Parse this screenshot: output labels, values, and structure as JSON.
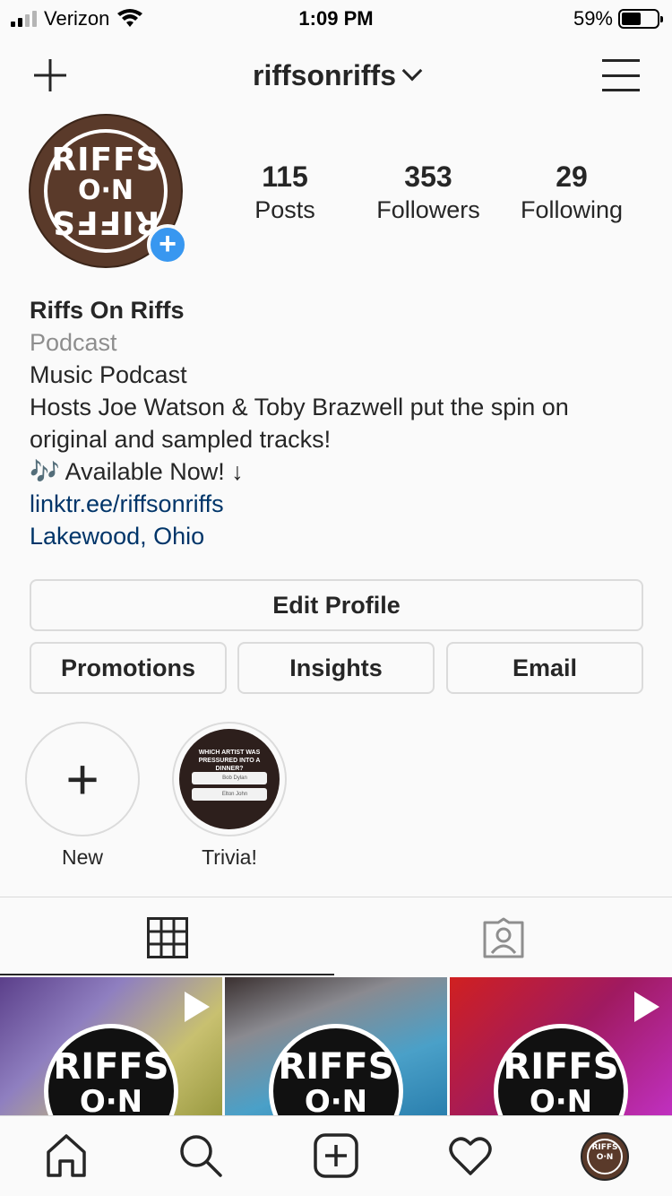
{
  "status_bar": {
    "carrier": "Verizon",
    "time": "1:09 PM",
    "battery": "59%",
    "battery_level": 0.59
  },
  "nav": {
    "username": "riffsonriffs"
  },
  "avatar": {
    "logo_top": "RIFFS",
    "logo_mid": "O·N",
    "logo_bottom": "RIFFS"
  },
  "stats": {
    "posts": {
      "value": "115",
      "label": "Posts"
    },
    "followers": {
      "value": "353",
      "label": "Followers"
    },
    "following": {
      "value": "29",
      "label": "Following"
    }
  },
  "bio": {
    "name": "Riffs On Riffs",
    "category": "Podcast",
    "line1": "Music Podcast",
    "line2": "Hosts Joe Watson & Toby Brazwell put the spin on original and sampled tracks!",
    "line3": "🎶 Available Now! ↓",
    "link": "linktr.ee/riffsonriffs",
    "location": "Lakewood, Ohio"
  },
  "buttons": {
    "edit_profile": "Edit Profile",
    "promotions": "Promotions",
    "insights": "Insights",
    "email": "Email"
  },
  "highlights": [
    {
      "label": "New"
    },
    {
      "label": "Trivia!",
      "question": "WHICH ARTIST WAS PRESSURED INTO A DINNER?",
      "option1": "Bob Dylan",
      "option2": "Elton John"
    }
  ],
  "grid": [
    {
      "logo_a": "RIFFS",
      "logo_b": "O·N",
      "bg": "#6a4a8a"
    },
    {
      "logo_a": "RIFFS",
      "logo_b": "O·N",
      "bg": "#4a8aa8"
    },
    {
      "logo_a": "RIFFS",
      "logo_b": "O·N",
      "bg": "#b02030"
    }
  ],
  "colors": {
    "accent": "#3897f0",
    "link": "#003569",
    "muted": "#8e8e8e"
  }
}
